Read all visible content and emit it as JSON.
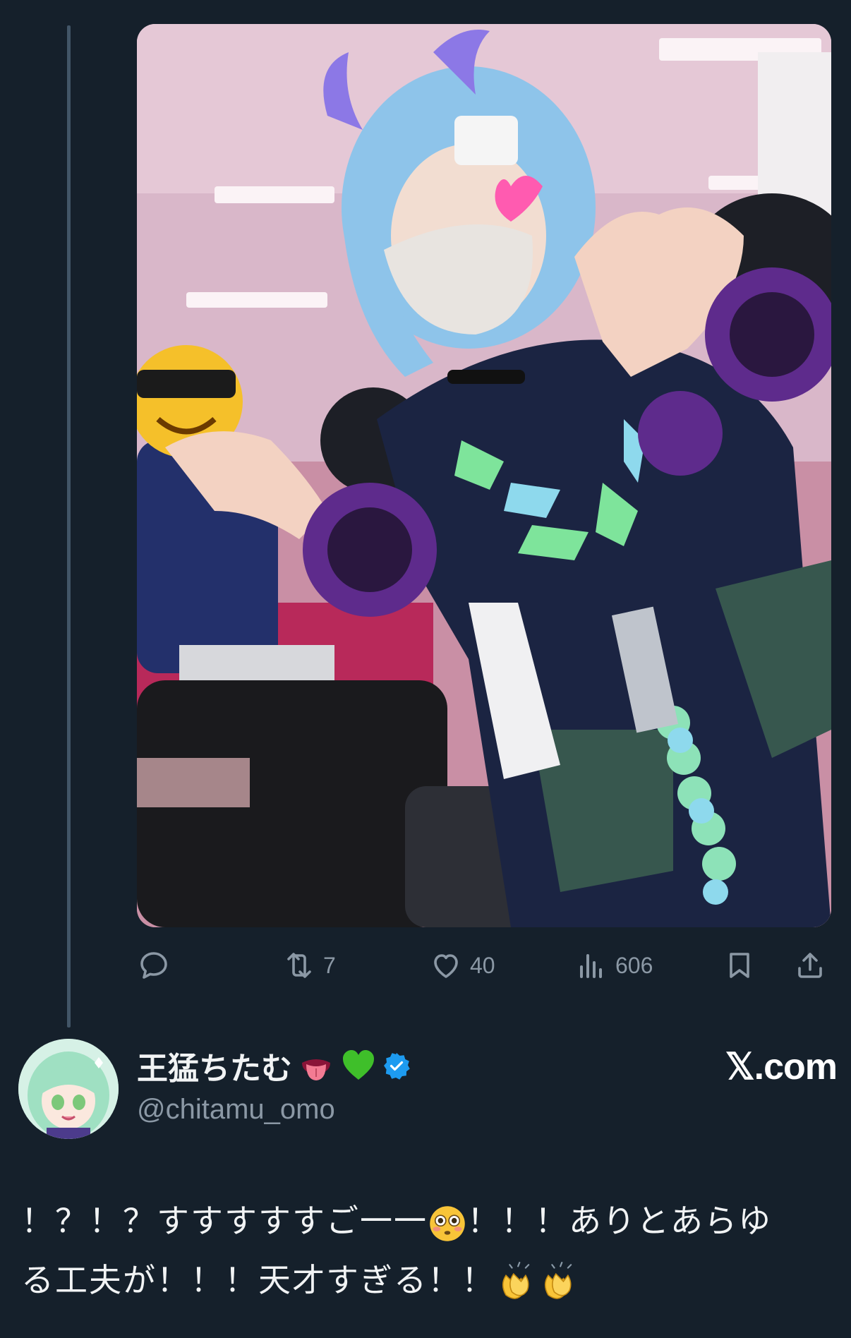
{
  "tweet": {
    "image_alt": "",
    "stats": {
      "replies": "",
      "retweets": "7",
      "likes": "40",
      "views": "606"
    }
  },
  "author": {
    "display_name": "王猛ちたむ",
    "handle": "@chitamu_omo",
    "verified": true,
    "name_emojis": [
      "tongue-emoji",
      "green-heart-emoji"
    ]
  },
  "source_site": "𝕏.com",
  "quoted_text": {
    "line1": "！？！？すすすすすご一一",
    "line1b": "！！！ありとあらゆ",
    "line2": "る工夫が！！！天才すぎる！！"
  },
  "colors": {
    "background": "#15202b",
    "muted": "#8b98a5",
    "verified_blue": "#1d9bf0"
  }
}
